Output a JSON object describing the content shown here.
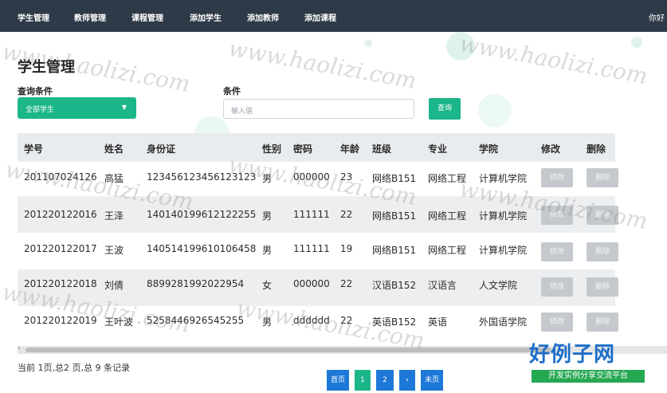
{
  "nav": {
    "items": [
      {
        "label": "学生管理"
      },
      {
        "label": "教师管理"
      },
      {
        "label": "课程管理"
      },
      {
        "label": "添加学生"
      },
      {
        "label": "添加教师"
      },
      {
        "label": "添加课程"
      }
    ],
    "user_partial": "你好"
  },
  "page_title": "学生管理",
  "filter": {
    "label": "查询条件",
    "selected": "全部学生",
    "condition_label": "条件",
    "input_placeholder": "输入值",
    "query_button": "查询"
  },
  "table": {
    "columns": [
      "学号",
      "姓名",
      "身份证",
      "性别",
      "密码",
      "年龄",
      "班级",
      "专业",
      "学院",
      "修改",
      "删除"
    ],
    "rows": [
      {
        "id": "201107024126",
        "name": "高猛",
        "idcard": "123456123456123123",
        "gender": "男",
        "password": "000000",
        "age": "23",
        "class": "网络B151",
        "major": "网络工程",
        "college": "计算机学院",
        "edit": "修改",
        "delete": "删除"
      },
      {
        "id": "201220122016",
        "name": "王泽",
        "idcard": "140140199612122255",
        "gender": "男",
        "password": "111111",
        "age": "22",
        "class": "网络B151",
        "major": "网络工程",
        "college": "计算机学院",
        "edit": "修改",
        "delete": "删除"
      },
      {
        "id": "201220122017",
        "name": "王波",
        "idcard": "140514199610106458",
        "gender": "男",
        "password": "111111",
        "age": "19",
        "class": "网络B151",
        "major": "网络工程",
        "college": "计算机学院",
        "edit": "修改",
        "delete": "删除"
      },
      {
        "id": "201220122018",
        "name": "刘倩",
        "idcard": "8899281992022954",
        "gender": "女",
        "password": "000000",
        "age": "22",
        "class": "汉语B152",
        "major": "汉语言",
        "college": "人文学院",
        "edit": "修改",
        "delete": "删除"
      },
      {
        "id": "201220122019",
        "name": "王叶波",
        "idcard": "5258446926545255",
        "gender": "男",
        "password": "dddddd",
        "age": "22",
        "class": "英语B152",
        "major": "英语",
        "college": "外国语学院",
        "edit": "修改",
        "delete": "删除"
      }
    ]
  },
  "pagination": {
    "info": "当前 1页,总2 页,总 9 条记录",
    "first": "首页",
    "pages": [
      "1",
      "2"
    ],
    "next": "›",
    "last": "末页"
  },
  "watermark": "www.haolizi.com",
  "logo": {
    "title": "好例子网",
    "tagline": "开发实例分享交流平台"
  },
  "colors": {
    "nav_bg": "#2e3a48",
    "accent_green": "#1bb68a",
    "pager_blue": "#1e78d8",
    "disabled_gray": "#c5c9cd"
  }
}
